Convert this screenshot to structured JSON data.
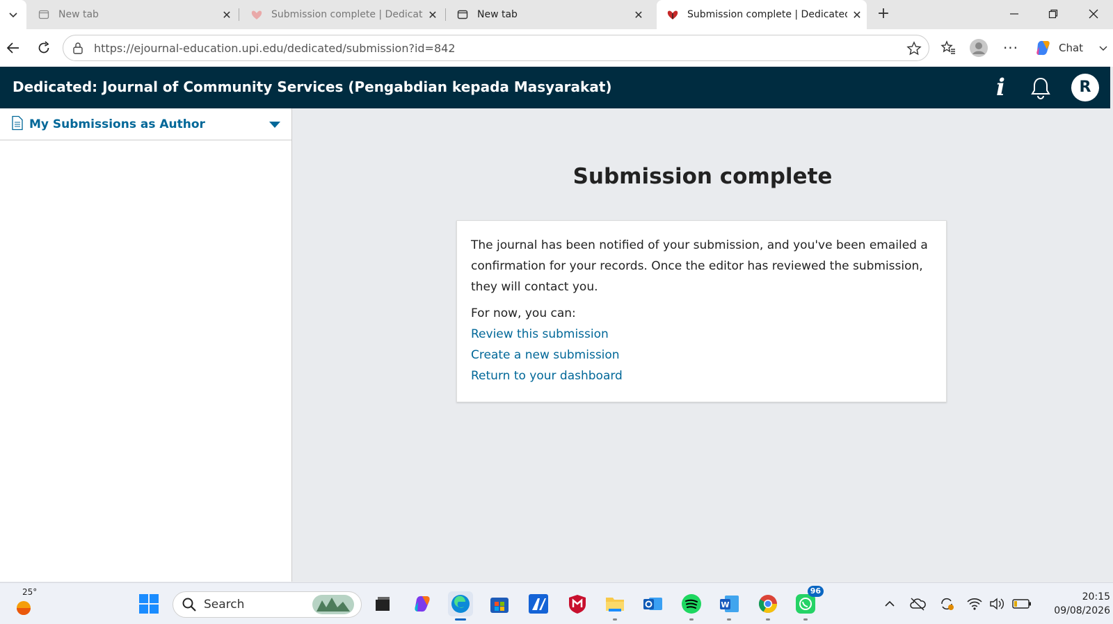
{
  "browser": {
    "tabs": [
      {
        "label": "New tab",
        "active": false
      },
      {
        "label": "Submission complete | Dedicated:",
        "active": false
      },
      {
        "label": "New tab",
        "active": false
      },
      {
        "label": "Submission complete | Dedicated:",
        "active": true
      }
    ],
    "url_host": "https://ejournal-education.upi.edu",
    "url_path": "/dedicated/submission?id=842",
    "chat_label": "Chat"
  },
  "app": {
    "title": "Dedicated: Journal of Community Services (Pengabdian kepada Masyarakat)",
    "info_glyph": "i",
    "avatar_initial": "R",
    "header_bg": "#002c40",
    "link_color": "#006798"
  },
  "sidebar": {
    "menu_label": "My Submissions as Author"
  },
  "main": {
    "title": "Submission complete",
    "message": "The journal has been notified of your submission, and you've been emailed a confirmation for your records. Once the editor has reviewed the submission, they will contact you.",
    "for_now": "For now, you can:",
    "links": [
      "Review this submission",
      "Create a new submission",
      "Return to your dashboard"
    ]
  },
  "taskbar": {
    "weather_temp": "25°",
    "search_label": "Search",
    "whatsapp_badge": "96",
    "time": "20:15",
    "date": "09/08/2026"
  }
}
